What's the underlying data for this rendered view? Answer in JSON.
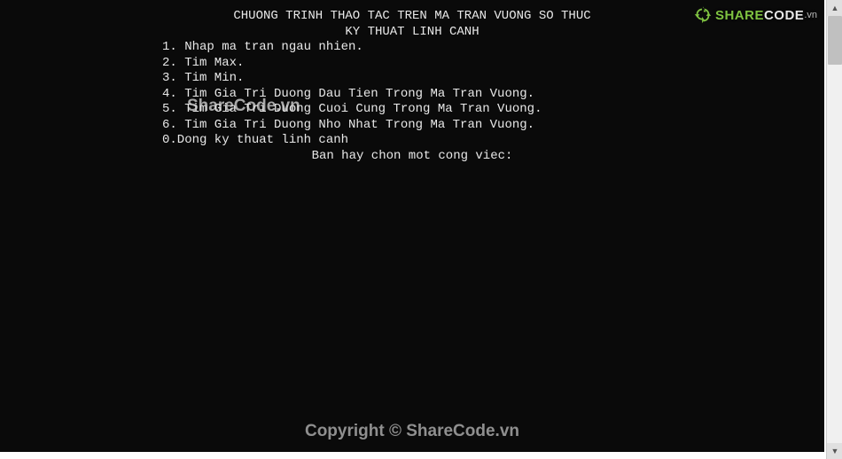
{
  "title1": "CHUONG TRINH THAO TAC TREN MA TRAN VUONG SO THUC",
  "title2": "KY THUAT LINH CANH",
  "menu": {
    "item1": "1. Nhap ma tran ngau nhien.",
    "item2": "2. Tim Max.",
    "item3": "3. Tim Min.",
    "item4": "4. Tim Gia Tri Duong Dau Tien Trong Ma Tran Vuong.",
    "item5": "5. Tim Gia Tri Duong Cuoi Cung Trong Ma Tran Vuong.",
    "item6": "6. Tim Gia Tri Duong Nho Nhat Trong Ma Tran Vuong.",
    "item0": "0.Dong ky thuat linh canh"
  },
  "prompt": "Ban hay chon mot cong viec:",
  "brand": {
    "share": "SHARE",
    "code": "CODE",
    "suffix": ".vn"
  },
  "watermark_center": "ShareCode.vn",
  "copyright": "Copyright © ShareCode.vn"
}
